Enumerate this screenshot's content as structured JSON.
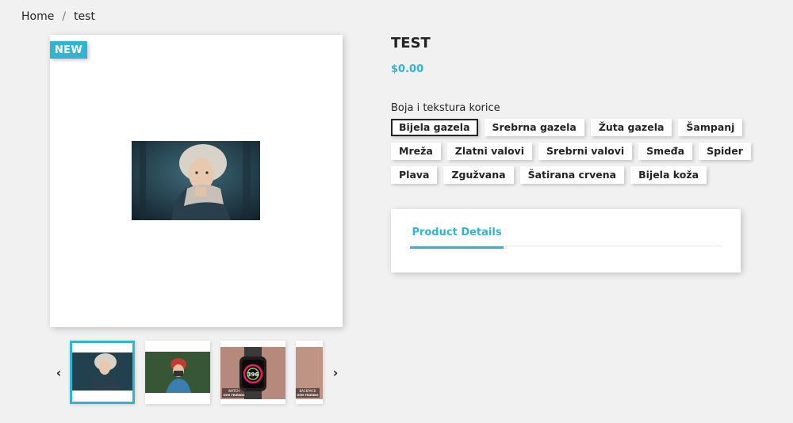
{
  "breadcrumb": {
    "items": [
      {
        "label": "Home"
      },
      {
        "label": "test"
      }
    ],
    "separator": "/"
  },
  "product": {
    "badge": "NEW",
    "title": "TEST",
    "price": "$0.00"
  },
  "gallery": {
    "prev_icon": "chevron-left-icon",
    "next_icon": "chevron-right-icon",
    "thumbnails": [
      {
        "name": "woman-hood",
        "selected": true
      },
      {
        "name": "woman-camera",
        "selected": false
      },
      {
        "name": "watch",
        "selected": false,
        "caption": "WATCH",
        "subcaption": "OEM FRIENDS",
        "display": "396"
      },
      {
        "name": "backpack",
        "selected": false,
        "caption": "BACKPACK",
        "subcaption": "OEM FRIENDS"
      }
    ]
  },
  "variants": {
    "label": "Boja i tekstura korice",
    "rows": [
      [
        "Bijela gazela",
        "Srebrna gazela",
        "Žuta gazela",
        "Šampanj"
      ],
      [
        "Mreža",
        "Zlatni valovi",
        "Srebrni valovi",
        "Smeđa",
        "Spider"
      ],
      [
        "Plava",
        "Zgužvana",
        "Šatirana crvena",
        "Bijela koža"
      ]
    ],
    "selected": "Bijela gazela"
  },
  "tabs": [
    {
      "label": "Product Details",
      "active": true
    }
  ],
  "colors": {
    "accent": "#2fb5d2",
    "background": "#f1f1f1"
  }
}
